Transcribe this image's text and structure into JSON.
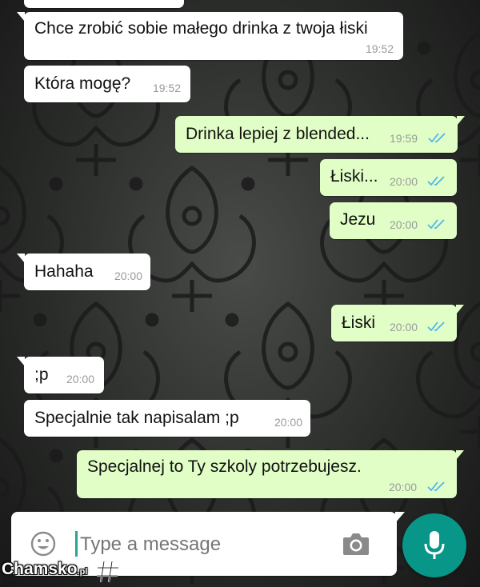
{
  "messages": [
    {
      "dir": "in",
      "text": "Chce zrobić sobie małego drinka z twoja łiski",
      "time": "19:52"
    },
    {
      "dir": "in",
      "text": "Która mogę?",
      "time": "19:52"
    },
    {
      "dir": "out",
      "text": "Drinka lepiej z blended...",
      "time": "19:59",
      "status": "read"
    },
    {
      "dir": "out",
      "text": "Łiski...",
      "time": "20:00",
      "status": "read"
    },
    {
      "dir": "out",
      "text": "Jezu",
      "time": "20:00",
      "status": "read"
    },
    {
      "dir": "in",
      "text": "Hahaha",
      "time": "20:00"
    },
    {
      "dir": "out",
      "text": "Łiski",
      "time": "20:00",
      "status": "read"
    },
    {
      "dir": "in",
      "text": ";p",
      "time": "20:00"
    },
    {
      "dir": "in",
      "text": "Specjalnie tak napisalam ;p",
      "time": "20:00"
    },
    {
      "dir": "out",
      "text": "Specjalnej to Ty szkoly potrzebujesz.",
      "time": "20:00",
      "status": "read"
    }
  ],
  "composer": {
    "placeholder": "Type a message",
    "emoji_icon": "emoji-icon",
    "camera_icon": "camera-icon",
    "mic_icon": "microphone-icon"
  },
  "watermark": {
    "brand": "Chamsko",
    "suffix": ".pl"
  },
  "colors": {
    "incoming_bubble": "#ffffff",
    "outgoing_bubble": "#e1fec6",
    "read_ticks": "#4fb6ec",
    "mic_button": "#089688"
  }
}
